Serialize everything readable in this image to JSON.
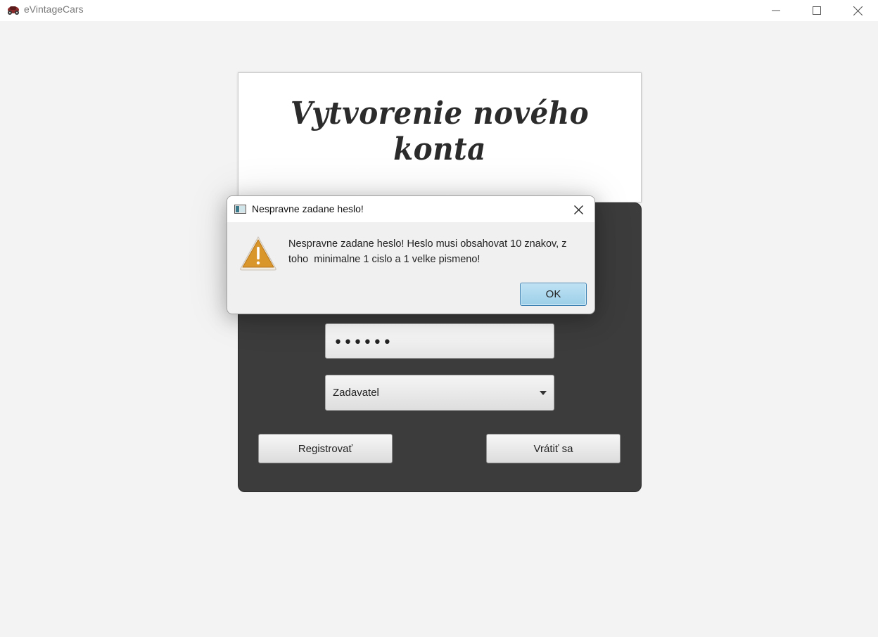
{
  "window": {
    "title": "eVintageCars",
    "icon": "vintage-car-icon",
    "controls": [
      "minimize-icon",
      "maximize-icon",
      "close-icon"
    ]
  },
  "header": {
    "title": "Vytvorenie nového konta"
  },
  "form": {
    "password_value": "••••••",
    "role_selected": "Zadavatel",
    "register_label": "Registrovať",
    "back_label": "Vrátiť sa"
  },
  "dialog": {
    "title": "Nespravne zadane heslo!",
    "message": "Nespravne zadane heslo! Heslo musi obsahovat 10 znakov, z\ntoho  minimalne 1 cislo a 1 velke pismeno!",
    "ok_label": "OK",
    "icon": "warning-icon"
  },
  "colors": {
    "panel": "#3c3c3c",
    "ok_button": "#a8d6ee",
    "warning": "#d9962b"
  }
}
